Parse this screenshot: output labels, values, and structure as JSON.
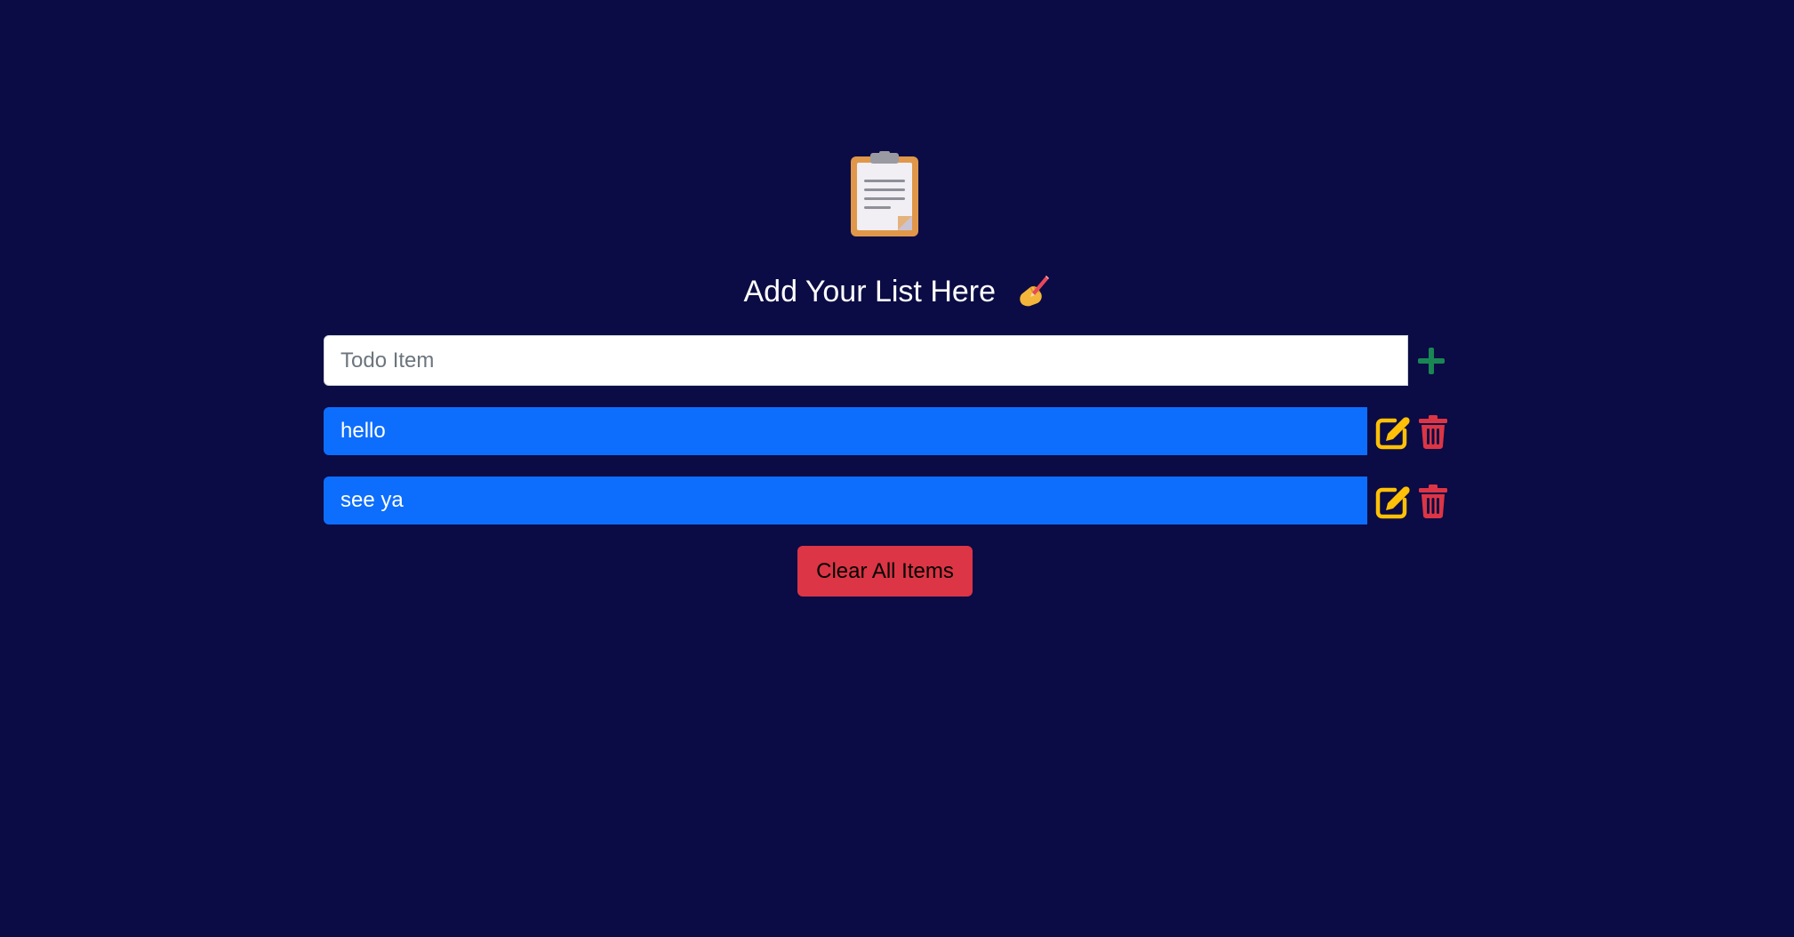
{
  "header": {
    "logo_icon": "clipboard-icon",
    "title": "Add Your List Here",
    "title_emoji_icon": "writing-hand-icon"
  },
  "input": {
    "placeholder": "Todo Item",
    "value": "",
    "add_icon": "plus-icon"
  },
  "items": [
    {
      "text": "hello",
      "edit_icon": "edit-icon",
      "delete_icon": "trash-icon"
    },
    {
      "text": "see ya",
      "edit_icon": "edit-icon",
      "delete_icon": "trash-icon"
    }
  ],
  "actions": {
    "clear_label": "Clear All Items"
  },
  "colors": {
    "background": "#0b0b45",
    "item_bg": "#0d6efd",
    "add": "#198754",
    "edit": "#ffc107",
    "delete": "#dc3545",
    "clear_bg": "#dc3545"
  }
}
